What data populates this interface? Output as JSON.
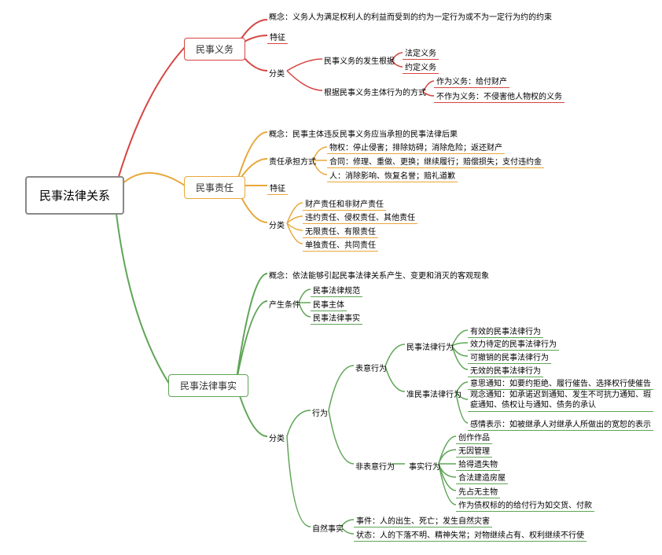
{
  "root": {
    "title": "民事法律关系"
  },
  "b1": {
    "title": "民事义务",
    "n1": {
      "label": "概念",
      "text": "义务人为满足权利人的利益而受到的约为一定行为或不为一定行为约的约束"
    },
    "n2": {
      "label": "特征"
    },
    "n3": {
      "label": "分类",
      "a": {
        "label": "民事义务的发生根据",
        "c1": "法定义务",
        "c2": "约定义务"
      },
      "b": {
        "label": "根据民事义务主体行为的方式",
        "c1": "作为义务：给付财产",
        "c2": "不作为义务：不侵害他人物权的义务"
      }
    }
  },
  "b2": {
    "title": "民事责任",
    "n1": {
      "label": "概念",
      "text": "民事主体违反民事义务应当承担的民事法律后果"
    },
    "n2": {
      "label": "责任承担方式",
      "c1": "物权：停止侵害；排除妨碍；消除危险；返还财产",
      "c2": "合同：修理、重做、更换；继续履行；赔偿损失；支付违约金",
      "c3": "人：消除影响、恢复名誉；赔礼道歉"
    },
    "n3": {
      "label": "特征"
    },
    "n4": {
      "label": "分类",
      "c1": "财产责任和非财产责任",
      "c2": "违约责任、侵权责任、其他责任",
      "c3": "无限责任、有限责任",
      "c4": "单独责任、共同责任"
    }
  },
  "b3": {
    "title": "民事法律事实",
    "n1": {
      "label": "概念",
      "text": "依法能够引起民事法律关系产生、变更和消灭的客观现象"
    },
    "n2": {
      "label": "产生条件",
      "c1": "民事法律规范",
      "c2": "民事主体",
      "c3": "民事法律事实"
    },
    "n3": {
      "label": "分类",
      "a": {
        "label": "行为",
        "a1": {
          "label": "表意行为",
          "m1": {
            "label": "民事法律行为",
            "c1": "有效的民事法律行为",
            "c2": "效力待定的民事法律行为",
            "c3": "可撤销的民事法律行为",
            "c4": "无效的民事法律行为"
          },
          "m2": {
            "label": "准民事法律行为",
            "c1": "意思通知：如要约拒绝、履行催告、选择权行使催告",
            "c2": "观念通知：如承诺迟到通知、发生不可抗力通知、瑕疵通知、债权让与通知、债务的承认",
            "c3": "感情表示：如被继承人对继承人所做出的宽恕的表示"
          }
        },
        "a2": {
          "label": "非表意行为",
          "m1": {
            "label": "事实行为",
            "c1": "创作作品",
            "c2": "无因管理",
            "c3": "拾得遗失物",
            "c4": "合法建造房屋",
            "c5": "先占无主物",
            "c6": "作为债权标的的给付行为如交货、付款"
          }
        }
      },
      "b": {
        "label": "自然事实",
        "c1": "事件：人的出生、死亡；发生自然灾害",
        "c2": "状态：人的下落不明、精神失常；对物继续占有、权利继续不行使"
      }
    }
  }
}
